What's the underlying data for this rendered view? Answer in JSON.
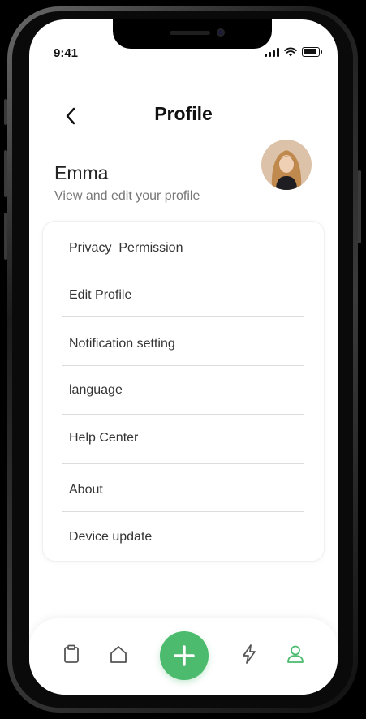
{
  "status_bar": {
    "time": "9:41"
  },
  "header": {
    "title": "Profile"
  },
  "user": {
    "name": "Emma",
    "subtitle": "View and edit your profile"
  },
  "menu": {
    "items": [
      {
        "label": "Privacy  Permission"
      },
      {
        "label": "Edit Profile"
      },
      {
        "label": "Notification setting"
      },
      {
        "label": "language"
      },
      {
        "label": "Help Center"
      },
      {
        "label": "About"
      },
      {
        "label": "Device update"
      }
    ]
  },
  "tab_bar": {
    "tabs": [
      {
        "icon": "clipboard-icon"
      },
      {
        "icon": "home-icon"
      },
      {
        "icon": "plus-icon"
      },
      {
        "icon": "lightning-icon"
      },
      {
        "icon": "user-icon",
        "active": true
      }
    ]
  },
  "colors": {
    "accent": "#4cbb6e",
    "text": "#333333",
    "muted": "#777777",
    "divider": "#dcdcdc"
  }
}
